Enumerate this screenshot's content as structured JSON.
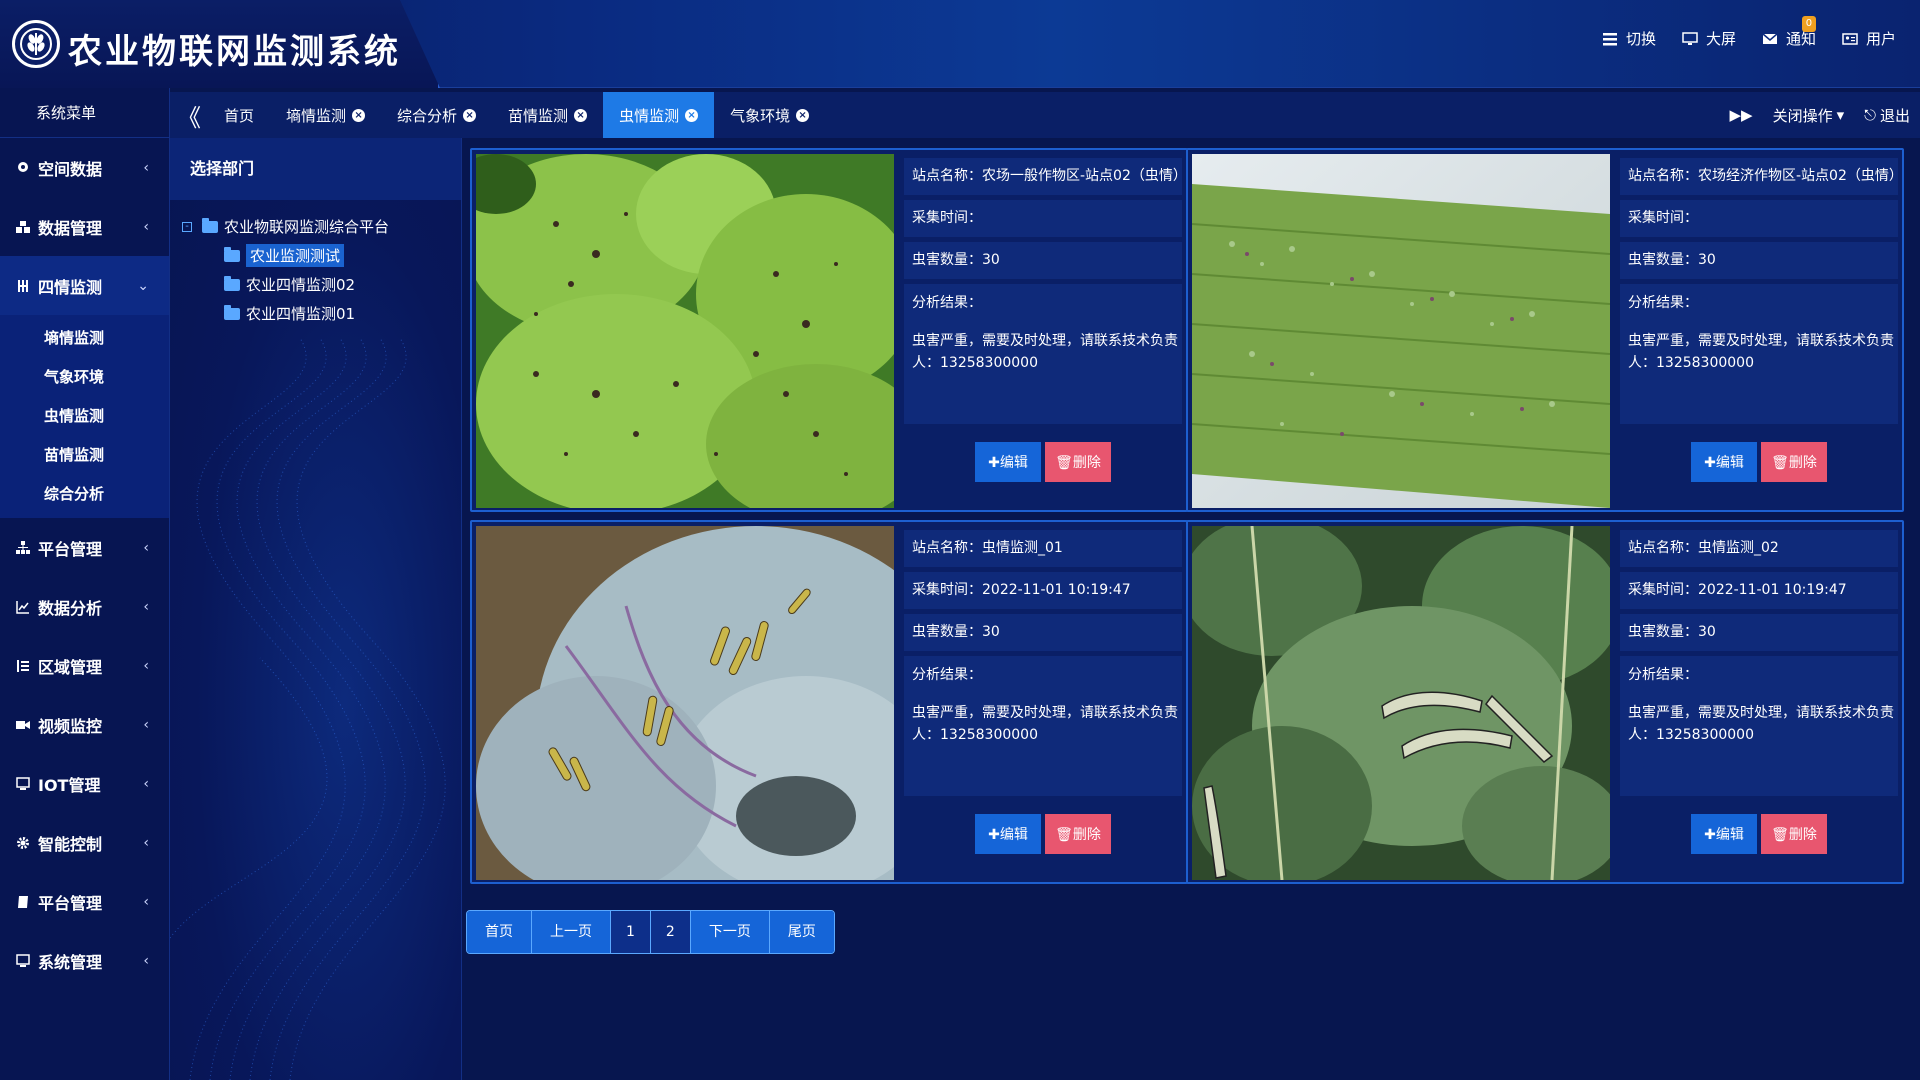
{
  "header": {
    "title": "农业物联网监测系统",
    "actions": [
      {
        "label": "切换",
        "icon": "list-icon"
      },
      {
        "label": "大屏",
        "icon": "monitor-icon"
      },
      {
        "label": "通知",
        "icon": "mail-icon",
        "badge": "0"
      },
      {
        "label": "用户",
        "icon": "user-card-icon"
      }
    ]
  },
  "tabs": {
    "items": [
      {
        "label": "首页",
        "closable": false
      },
      {
        "label": "墒情监测",
        "closable": true
      },
      {
        "label": "综合分析",
        "closable": true
      },
      {
        "label": "苗情监测",
        "closable": true
      },
      {
        "label": "虫情监测",
        "closable": true,
        "active": true
      },
      {
        "label": "气象环境",
        "closable": true
      }
    ],
    "forward": "⏩",
    "close_ops": "关闭操作",
    "logout": "退出"
  },
  "sidebar": {
    "title": "系统菜单",
    "items": [
      {
        "label": "空间数据",
        "icon": "location-icon"
      },
      {
        "label": "数据管理",
        "icon": "cubes-icon"
      },
      {
        "label": "四情监测",
        "icon": "fork-icon",
        "open": true
      },
      {
        "label": "平台管理",
        "icon": "sitemap-icon"
      },
      {
        "label": "数据分析",
        "icon": "line-chart-icon"
      },
      {
        "label": "区域管理",
        "icon": "list-ol-icon"
      },
      {
        "label": "视频监控",
        "icon": "video-camera-icon"
      },
      {
        "label": "IOT管理",
        "icon": "desktop-icon"
      },
      {
        "label": "智能控制",
        "icon": "cog-icon"
      },
      {
        "label": "平台管理",
        "icon": "book-icon"
      },
      {
        "label": "系统管理",
        "icon": "monitor-icon"
      }
    ],
    "submenu": [
      "墒情监测",
      "气象环境",
      "虫情监测",
      "苗情监测",
      "综合分析"
    ]
  },
  "dept": {
    "title": "选择部门",
    "root": "农业物联网监测综合平台",
    "children": [
      "农业监测测试",
      "农业四情监测02",
      "农业四情监测01"
    ]
  },
  "labels": {
    "station": "站点名称：",
    "time": "采集时间：",
    "count": "虫害数量：",
    "result": "分析结果：",
    "edit": "✚编辑",
    "delete": "🗑删除"
  },
  "cards": [
    {
      "station": "农场一般作物区-站点02（虫情）",
      "time": "",
      "count": "30",
      "result": "虫害严重，需要及时处理，请联系技术负责人：13258300000",
      "photo": "leaf-holes"
    },
    {
      "station": "农场经济作物区-站点02（虫情）",
      "time": "",
      "count": "30",
      "result": "虫害严重，需要及时处理，请联系技术负责人：13258300000",
      "photo": "aphids"
    },
    {
      "station": "虫情监测_01",
      "time": "2022-11-01 10:19:47",
      "count": "30",
      "result": "虫害严重，需要及时处理，请联系技术负责人：13258300000",
      "photo": "cabbage"
    },
    {
      "station": "虫情监测_02",
      "time": "2022-11-01 10:19:47",
      "count": "30",
      "result": "虫害严重，需要及时处理，请联系技术负责人：13258300000",
      "photo": "caterpillar"
    }
  ],
  "pager": [
    "首页",
    "上一页",
    "1",
    "2",
    "下一页",
    "尾页"
  ]
}
